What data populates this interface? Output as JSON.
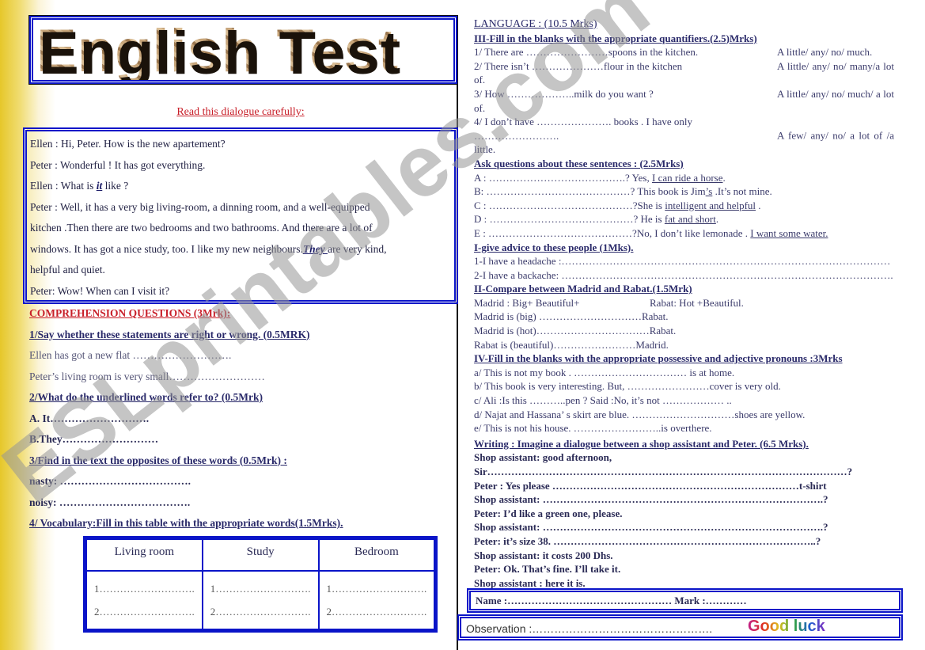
{
  "title": "English Test",
  "watermark": "ESLprintables.com",
  "read_instruction": "Read this dialogue  carefully:",
  "dialogue": [
    {
      "pre": "Ellen : Hi, Peter. How is the new apartement?",
      "em": "",
      "post": ""
    },
    {
      "pre": "Peter : Wonderful ! It has got everything.",
      "em": "",
      "post": ""
    },
    {
      "pre": "Ellen : What is ",
      "em": "it",
      "post": " like ?"
    },
    {
      "pre": "Peter : Well, it has a very big living-room, a dinning room, and a well-equipped",
      "em": "",
      "post": ""
    },
    {
      "pre": "kitchen .Then there are two bedrooms and two bathrooms. And there are a lot of",
      "em": "",
      "post": ""
    },
    {
      "pre": "windows. It has got a nice study, too. I like my new neighbours.",
      "em": "They ",
      "post": "are very kind,"
    },
    {
      "pre": "helpful  and quiet.",
      "em": "",
      "post": ""
    },
    {
      "pre": "Peter: Wow! When can I visit it?",
      "em": "",
      "post": ""
    }
  ],
  "comprehension": {
    "heading": "COMPREHENSION QUESTIONS (3Mrk):",
    "q1": "1/Say whether these statements are right   or wrong. (0.5MRK)",
    "q1_items": [
      "Ellen has got a new flat  ……………………….",
      "Peter’s living room is very small………………………"
    ],
    "q2": "2/What do the underlined words refer to? (0.5Mrk)",
    "q2_items": [
      "A. It……………………….",
      "B.They………………………"
    ],
    "q3": "3/Find in the text the opposites of  these words (0.5Mrk) :",
    "q3_items": [
      "nasty: ……………………………….",
      "noisy: ………………………………."
    ],
    "q4": "4/ Vocabulary:Fill in this table with the appropriate words(1.5Mrks)."
  },
  "vocab_table": {
    "headers": [
      "Living room",
      "Study",
      "Bedroom"
    ],
    "blank1": "1……………………….",
    "blank2": "2………………………."
  },
  "language": {
    "heading": "LANGUAGE : (10.5 Mrks)",
    "quant_heading": "III-Fill in the blanks with the appropriate quantifiers.(2.5)Mrks)",
    "quant_items": [
      {
        "sentence": "1/ There are ……………………spoons in the kitchen.",
        "options": "A little/ any/ no/ much."
      },
      {
        "sentence": "2/ There isn’t  …………………flour  in the kitchen",
        "options": "A little/ any/ no/ many/a lot of."
      },
      {
        "sentence": "3/ How ………………..milk do you want ?",
        "options": "A little/  any/  no/  much/ a lot of."
      },
      {
        "sentence": "4/ I don’t have …………………. books . I have only …………………….",
        "options": "A few/ any/ no/ a lot of /a little."
      }
    ],
    "ask_heading": "Ask  questions about  these sentences : (2.5Mrks)",
    "ask_items": [
      {
        "pre": "A : ………………………………….? Yes, ",
        "u": "I can ride a horse",
        "post": "."
      },
      {
        "pre": "B: ……………………………………? This book is Jim",
        "u": "’s",
        "post": " .It’s not mine."
      },
      {
        "pre": "C : ……………………………………?She is ",
        "u": "intelligent and helpful",
        "post": " ."
      },
      {
        "pre": "D : ……………………………………? He is ",
        "u": "fat and short",
        "post": "."
      },
      {
        "pre": "E : ……………………………………?No, I don’t like lemonade . ",
        "u": "I want some water.",
        "post": ""
      }
    ],
    "advice_heading": "I-give advice to these people (1Mks).",
    "advice_items": [
      "1-I have a headache :……………………………………………………………………………………",
      "2-I have a backache: ……………………………………………………………………………………."
    ],
    "compare_heading": "II-Compare between  Madrid and Rabat.(1.5Mrk)",
    "compare_info_left": "Madrid : Big+ Beautiful+",
    "compare_info_right": "Rabat: Hot +Beautiful.",
    "compare_items": [
      "Madrid is (big)  …………………………Rabat.",
      "Madrid is (hot)……………………………Rabat.",
      "Rabat  is (beautiful)……………………Madrid."
    ],
    "pronoun_heading": "IV-Fill in the blanks with the appropriate possessive and adjective pronouns :3Mrks",
    "pronoun_items": [
      "a/ This is not my book . …………………………… is at home.",
      "b/ This book is very interesting. But, ……………………cover is very old.",
      "c/  Ali :Is this ………..pen ? Said :No, it’s not ……………… ..",
      "d/ Najat and  Hassana’ s skirt are blue. …………………………shoes are yellow.",
      "e/ This is not his  house. ……………………..is overthere."
    ],
    "writing_heading": "Writing : Imagine a dialogue between a shop assistant and Peter. (6.5 Mrks).",
    "writing_lines": [
      "Shop assistant: good afternoon,",
      "Sir……………………………………………………………………………………………?",
      "Peter : Yes please ………………………………………………………………t-shirt",
      "Shop assistant: ……………………………………………………………………….?",
      "Peter: I’d like a green one, please.",
      "Shop assistant: ……………………………………………………………………….?",
      "Peter: it’s size 38.  …………………………………………………………………..?",
      "Shop assistant: it costs 200 Dhs.",
      "Peter:  Ok. That’s fine. I’ll take it.",
      "Shop assistant : here it is."
    ]
  },
  "footer": {
    "name": "Name :………………………………………… Mark :…………",
    "observation": "Observation :………………………………………….",
    "good_luck": "Good luck"
  },
  "colors": {
    "border_blue": "#0a14c8",
    "heading_red": "#c81e28",
    "text_navy": "#2e2e5e",
    "edge_yellow": "#e6c72a"
  }
}
